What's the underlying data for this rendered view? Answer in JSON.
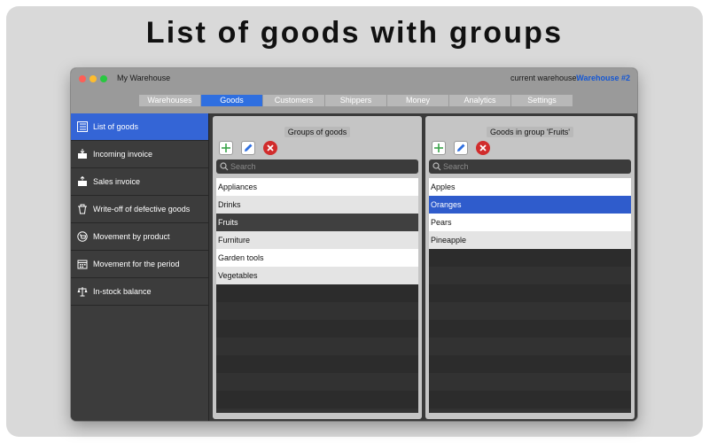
{
  "headline": "List of goods with groups",
  "window": {
    "title": "My Warehouse",
    "warehouse_label": "current warehouse:",
    "warehouse_value": "Warehouse #2"
  },
  "tabs": [
    {
      "label": "Warehouses",
      "active": false
    },
    {
      "label": "Goods",
      "active": true
    },
    {
      "label": "Customers",
      "active": false
    },
    {
      "label": "Shippers",
      "active": false
    },
    {
      "label": "Money",
      "active": false
    },
    {
      "label": "Analytics",
      "active": false
    },
    {
      "label": "Settings",
      "active": false
    }
  ],
  "sidebar": {
    "items": [
      {
        "label": "List of goods",
        "icon": "list-icon",
        "active": true
      },
      {
        "label": "Incoming invoice",
        "icon": "box-in-icon",
        "active": false
      },
      {
        "label": "Sales invoice",
        "icon": "box-out-icon",
        "active": false
      },
      {
        "label": "Write-off of defective goods",
        "icon": "trash-icon",
        "active": false
      },
      {
        "label": "Movement by product",
        "icon": "cart-icon",
        "active": false
      },
      {
        "label": "Movement for the period",
        "icon": "calendar-icon",
        "active": false
      },
      {
        "label": "In-stock balance",
        "icon": "scales-icon",
        "active": false
      }
    ]
  },
  "groups_panel": {
    "title": "Groups of goods",
    "search_placeholder": "Search",
    "items": [
      "Appliances",
      "Drinks",
      "Fruits",
      "Furniture",
      "Garden tools",
      "Vegetables"
    ],
    "selected": "Fruits"
  },
  "goods_panel": {
    "title": "Goods in group 'Fruits'",
    "search_placeholder": "Search",
    "items": [
      "Apples",
      "Oranges",
      "Pears",
      "Pineapple"
    ],
    "selected": "Oranges"
  },
  "colors": {
    "accent": "#2f6fe0",
    "selection_blue": "#2f5ccc",
    "selection_dark": "#404040",
    "add_green": "#3aa34a",
    "delete_red": "#d12c2c"
  }
}
